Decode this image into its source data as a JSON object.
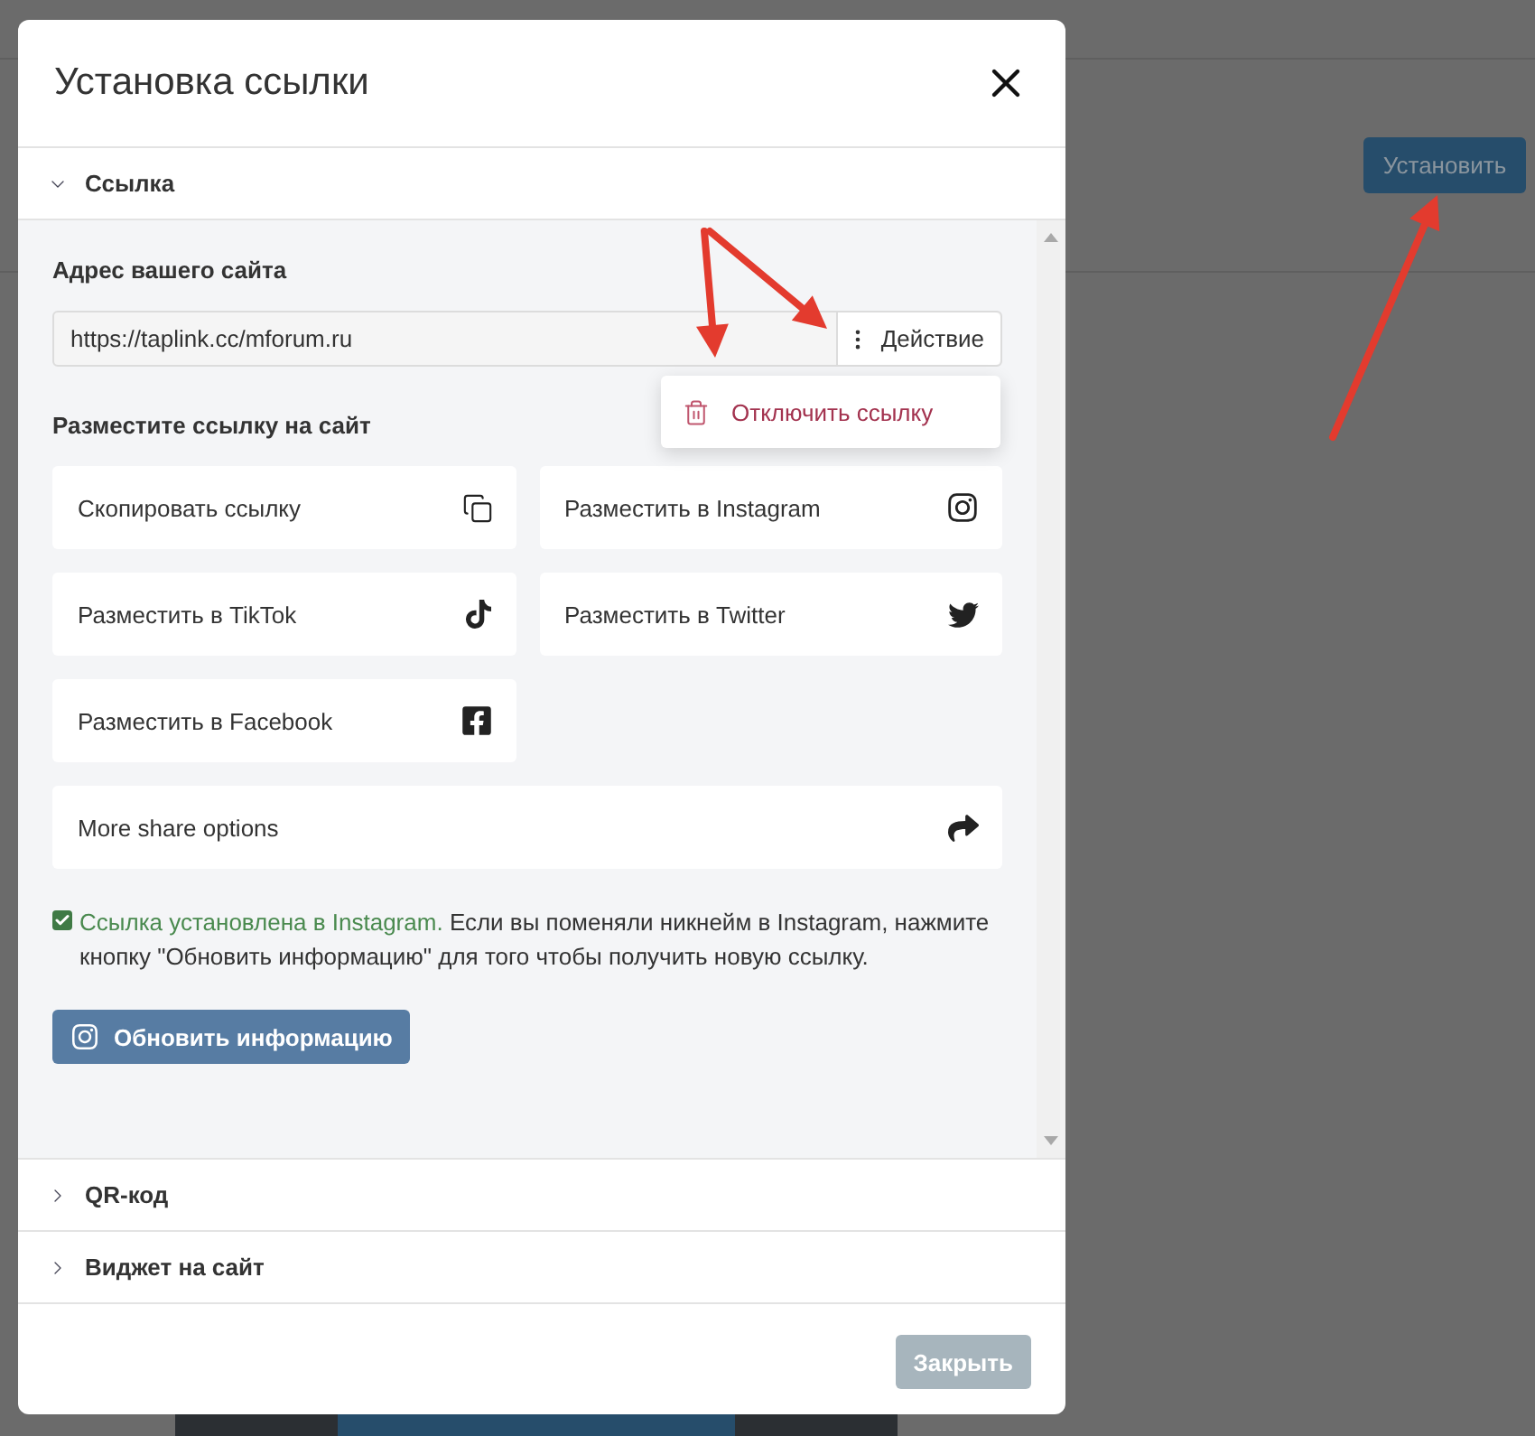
{
  "background": {
    "install_button": "Установить"
  },
  "dialog": {
    "title": "Установка ссылки",
    "sections": [
      {
        "title": "Ссылка",
        "expanded": true
      },
      {
        "title": "QR-код",
        "expanded": false
      },
      {
        "title": "Виджет на сайт",
        "expanded": false
      }
    ],
    "link": {
      "address_label": "Адрес вашего сайта",
      "address_value": "https://taplink.cc/mforum.ru",
      "action_button": "Действие",
      "action_menu": [
        {
          "label": "Отключить ссылку"
        }
      ],
      "place_label": "Разместите ссылку на сайт",
      "share_options": [
        {
          "label": "Скопировать ссылку",
          "kind": "copy"
        },
        {
          "label": "Разместить в Instagram",
          "kind": "instagram"
        },
        {
          "label": "Разместить в TikTok",
          "kind": "tiktok"
        },
        {
          "label": "Разместить в Twitter",
          "kind": "twitter"
        },
        {
          "label": "Разместить в Facebook",
          "kind": "facebook"
        },
        {
          "label": "More share options",
          "kind": "share"
        }
      ],
      "notice": {
        "checked": true,
        "highlight": "Ссылка установлена в Instagram.",
        "text": "Если вы поменяли никнейм в Instagram, нажмите кнопку \"Обновить информацию\" для того чтобы получить новую ссылку."
      },
      "refresh_button": "Обновить информацию"
    },
    "close_button": "Закрыть"
  }
}
